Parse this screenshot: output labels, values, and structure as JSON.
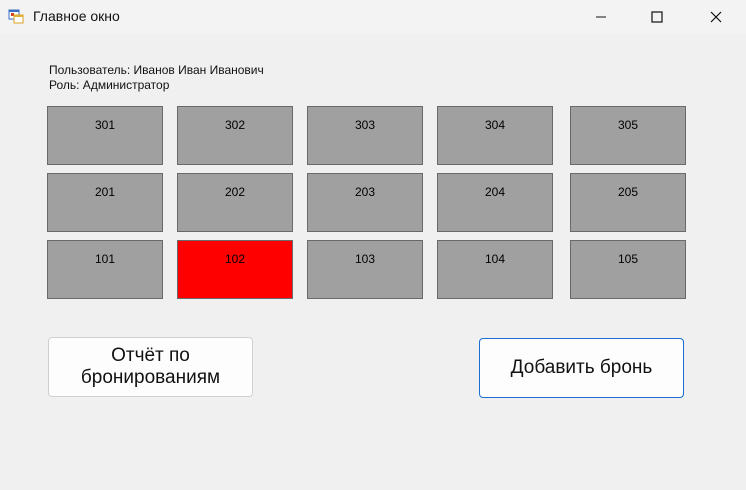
{
  "window": {
    "title": "Главное окно",
    "icon": "app-form-icon"
  },
  "user": {
    "name_line": "Пользователь: Иванов Иван Иванович",
    "role_line": "Роль: Администратор"
  },
  "rooms": [
    {
      "number": "301",
      "status": "free"
    },
    {
      "number": "302",
      "status": "free"
    },
    {
      "number": "303",
      "status": "free"
    },
    {
      "number": "304",
      "status": "free"
    },
    {
      "number": "305",
      "status": "free"
    },
    {
      "number": "201",
      "status": "free"
    },
    {
      "number": "202",
      "status": "free"
    },
    {
      "number": "203",
      "status": "free"
    },
    {
      "number": "204",
      "status": "free"
    },
    {
      "number": "205",
      "status": "free"
    },
    {
      "number": "101",
      "status": "free"
    },
    {
      "number": "102",
      "status": "busy"
    },
    {
      "number": "103",
      "status": "free"
    },
    {
      "number": "104",
      "status": "free"
    },
    {
      "number": "105",
      "status": "free"
    }
  ],
  "colors": {
    "free": "#a0a0a0",
    "busy": "#ff0000",
    "accent": "#1a6fd1"
  },
  "buttons": {
    "report": "Отчёт по бронированиям",
    "add_booking": "Добавить бронь"
  }
}
